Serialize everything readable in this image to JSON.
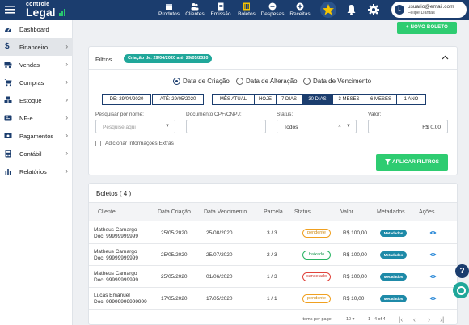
{
  "app": {
    "logo_top": "controle",
    "logo_bottom": "Legal",
    "brand_color": "#1b3d6e",
    "accent_green": "#2ecc71"
  },
  "topnav": [
    {
      "label": "Produtos",
      "icon": "box-icon"
    },
    {
      "label": "Clientes",
      "icon": "users-icon"
    },
    {
      "label": "Emissão",
      "icon": "document-icon"
    },
    {
      "label": "Boletos",
      "icon": "barcode-icon"
    },
    {
      "label": "Despesas",
      "icon": "minus-circle-icon"
    },
    {
      "label": "Receitas",
      "icon": "plus-circle-icon"
    }
  ],
  "user": {
    "avatar_letter": "L",
    "email": "usuario@email.com",
    "name": "Felipe Dantas"
  },
  "sidebar": [
    {
      "label": "Dashboard",
      "icon": "dashboard-icon",
      "arrow": false
    },
    {
      "label": "Financeiro",
      "icon": "dollar-icon",
      "arrow": true
    },
    {
      "label": "Vendas",
      "icon": "cart-icon",
      "arrow": true
    },
    {
      "label": "Compras",
      "icon": "shopping-cart-icon",
      "arrow": true
    },
    {
      "label": "Estoque",
      "icon": "boxes-icon",
      "arrow": true
    },
    {
      "label": "NF-e",
      "icon": "invoice-icon",
      "arrow": true
    },
    {
      "label": "Pagamentos",
      "icon": "money-icon",
      "arrow": true
    },
    {
      "label": "Contábil",
      "icon": "calculator-icon",
      "arrow": true
    },
    {
      "label": "Relatórios",
      "icon": "chart-bar-icon",
      "arrow": true
    }
  ],
  "actions": {
    "new_boleto": "+ NOVO BOLETO"
  },
  "filters": {
    "title": "Filtros",
    "badge": "Criação de: 29/04/2020 até: 29/05/2020",
    "radios": [
      {
        "label": "Data de Criação",
        "selected": true
      },
      {
        "label": "Data de Alteração",
        "selected": false
      },
      {
        "label": "Data de Vencimento",
        "selected": false
      }
    ],
    "date_from": "DE: 29/04/2020",
    "date_to": "ATÉ: 29/05/2020",
    "periods": [
      {
        "label": "MÊS ATUAL",
        "selected": false
      },
      {
        "label": "HOJE",
        "selected": false
      },
      {
        "label": "7 DIAS",
        "selected": false
      },
      {
        "label": "30 DIAS",
        "selected": true
      },
      {
        "label": "3 MESES",
        "selected": false
      },
      {
        "label": "6 MESES",
        "selected": false
      },
      {
        "label": "1 ANO",
        "selected": false
      }
    ],
    "search_label": "Pesquisar por nome:",
    "search_placeholder": "Pesquise aqui",
    "doc_label": "Documento CPF/CNPJ:",
    "doc_value": "",
    "status_label": "Status:",
    "status_value": "Todos",
    "valor_label": "Valor:",
    "valor_value": "R$ 0,00",
    "extra_info": "Adicionar Informações Extras",
    "apply": "APLICAR FILTROS"
  },
  "boletos": {
    "title": "Boletos ( 4 )",
    "columns": [
      "Cliente",
      "Data Criação",
      "Data Vencimento",
      "Parcela",
      "Status",
      "Valor",
      "Metadados",
      "Ações"
    ],
    "rows": [
      {
        "name": "Matheus Camargo",
        "doc": "Doc: 99999999999",
        "created": "25/05/2020",
        "due": "25/08/2020",
        "parcel": "3 / 3",
        "status": "pendente",
        "status_color": "#f0a020",
        "value": "R$ 100,00",
        "meta": "Metadados"
      },
      {
        "name": "Matheus Camargo",
        "doc": "Doc: 99999999999",
        "created": "25/05/2020",
        "due": "25/07/2020",
        "parcel": "2 / 3",
        "status": "baixado",
        "status_color": "#28b463",
        "value": "R$ 100,00",
        "meta": "Metadados"
      },
      {
        "name": "Matheus Camargo",
        "doc": "Doc: 99999999999",
        "created": "25/05/2020",
        "due": "01/06/2020",
        "parcel": "1 / 3",
        "status": "cancelado",
        "status_color": "#e0433b",
        "value": "R$ 100,00",
        "meta": "Metadados"
      },
      {
        "name": "Lucas Emanuel",
        "doc": "Doc: 99999999999999",
        "created": "17/05/2020",
        "due": "17/05/2020",
        "parcel": "1 / 1",
        "status": "pendente",
        "status_color": "#f0a020",
        "value": "R$ 10,00",
        "meta": "Metadados"
      }
    ],
    "items_per_page_label": "Items per page:",
    "items_per_page": "10",
    "range": "1 - 4 of 4"
  }
}
